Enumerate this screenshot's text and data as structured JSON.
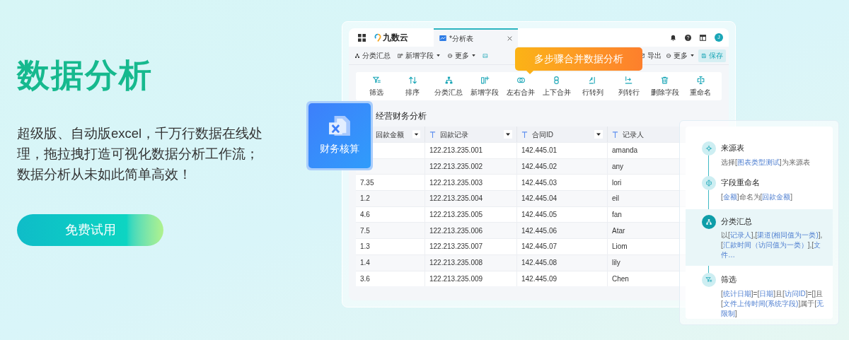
{
  "hero": {
    "title": "数据分析",
    "description": "超级版、自动版excel，千万行数据在线处理，拖拉拽打造可视化数据分析工作流；数据分析从未如此简单高效！",
    "cta": "免费试用"
  },
  "app": {
    "logo": "九数云",
    "avatar": "J",
    "tabs": [
      {
        "label": "*分析表",
        "selected": true
      }
    ],
    "toolbar_left": [
      {
        "label": "分类汇总",
        "kind": "group"
      },
      {
        "label": "新增字段",
        "kind": "add",
        "dropdown": true
      },
      {
        "label": "更多",
        "kind": "more",
        "dropdown": true
      },
      {
        "kind": "image"
      }
    ],
    "toolbar_right": [
      {
        "label": "导出",
        "kind": "export"
      },
      {
        "label": "更多",
        "kind": "more",
        "dropdown": true
      },
      {
        "label": "保存",
        "kind": "save"
      }
    ],
    "operations": [
      {
        "label": "筛选",
        "kind": "filter"
      },
      {
        "label": "排序",
        "kind": "sort"
      },
      {
        "label": "分类汇总",
        "kind": "group"
      },
      {
        "label": "新增字段",
        "kind": "add"
      },
      {
        "label": "左右合并",
        "kind": "merge_lr"
      },
      {
        "label": "上下合并",
        "kind": "merge_tb"
      },
      {
        "label": "行转列",
        "kind": "row_col"
      },
      {
        "label": "列转行",
        "kind": "col_row"
      },
      {
        "label": "删除字段",
        "kind": "delete"
      },
      {
        "label": "重命名",
        "kind": "rename"
      }
    ],
    "callout": "多步骤合并数据分析",
    "table": {
      "title": "经营财务分析",
      "columns": [
        {
          "label": "回款金额",
          "type_icon": false
        },
        {
          "label": "回款记录",
          "type_icon": true
        },
        {
          "label": "合同ID",
          "type_icon": true
        },
        {
          "label": "记录人",
          "type_icon": true
        }
      ],
      "rows": [
        [
          null,
          "122.213.235.001",
          "142.445.01",
          "amanda"
        ],
        [
          null,
          "122.213.235.002",
          "142.445.02",
          "any"
        ],
        [
          "7.35",
          "122.213.235.003",
          "142.445.03",
          "lori"
        ],
        [
          "1.2",
          "122.213.235.004",
          "142.445.04",
          "eil"
        ],
        [
          "4.6",
          "122.213.235.005",
          "142.445.05",
          "fan"
        ],
        [
          "7.5",
          "122.213.235.006",
          "142.445.06",
          "Atar"
        ],
        [
          "1.3",
          "122.213.235.007",
          "142.445.07",
          "Liom"
        ],
        [
          "1.4",
          "122.213.235.008",
          "142.445.08",
          "lily"
        ],
        [
          "3.6",
          "122.213.235.009",
          "142.445.09",
          "Chen"
        ]
      ]
    }
  },
  "badge": {
    "label": "财务核算"
  },
  "steps": [
    {
      "title": "来源表",
      "kind": "source",
      "selected": false,
      "description": [
        {
          "text": "选择[",
          "field": false
        },
        {
          "text": "图表类型测试",
          "field": true
        },
        {
          "text": "]为来源表",
          "field": false
        }
      ]
    },
    {
      "title": "字段重命名",
      "kind": "rename",
      "selected": false,
      "description": [
        {
          "text": "[",
          "field": false
        },
        {
          "text": "金额",
          "field": true
        },
        {
          "text": "]命名为[",
          "field": false
        },
        {
          "text": "回款金额",
          "field": true
        },
        {
          "text": "]",
          "field": false
        }
      ]
    },
    {
      "title": "分类汇总",
      "kind": "group",
      "selected": true,
      "description": [
        {
          "text": "以[",
          "field": false
        },
        {
          "text": "记录人",
          "field": true
        },
        {
          "text": "],[",
          "field": false
        },
        {
          "text": "渠道(相同值为一类)",
          "field": true
        },
        {
          "text": "],[",
          "field": false
        },
        {
          "text": "汇款时间（访问值为一类）",
          "field": true
        },
        {
          "text": "],[",
          "field": false
        },
        {
          "text": "文件…",
          "field": true
        }
      ]
    },
    {
      "title": "筛选",
      "kind": "filter",
      "selected": false,
      "description": [
        {
          "text": "[",
          "field": false
        },
        {
          "text": "统计日期",
          "field": true
        },
        {
          "text": "]=[",
          "field": false
        },
        {
          "text": "日期",
          "field": true
        },
        {
          "text": "]且[",
          "field": false
        },
        {
          "text": "访问ID",
          "field": true
        },
        {
          "text": "]=[]且[",
          "field": false
        },
        {
          "text": "文件上传时间(系统字段)",
          "field": true
        },
        {
          "text": "]属于[",
          "field": false
        },
        {
          "text": "无限制",
          "field": true
        },
        {
          "text": "]",
          "field": false
        }
      ]
    }
  ]
}
